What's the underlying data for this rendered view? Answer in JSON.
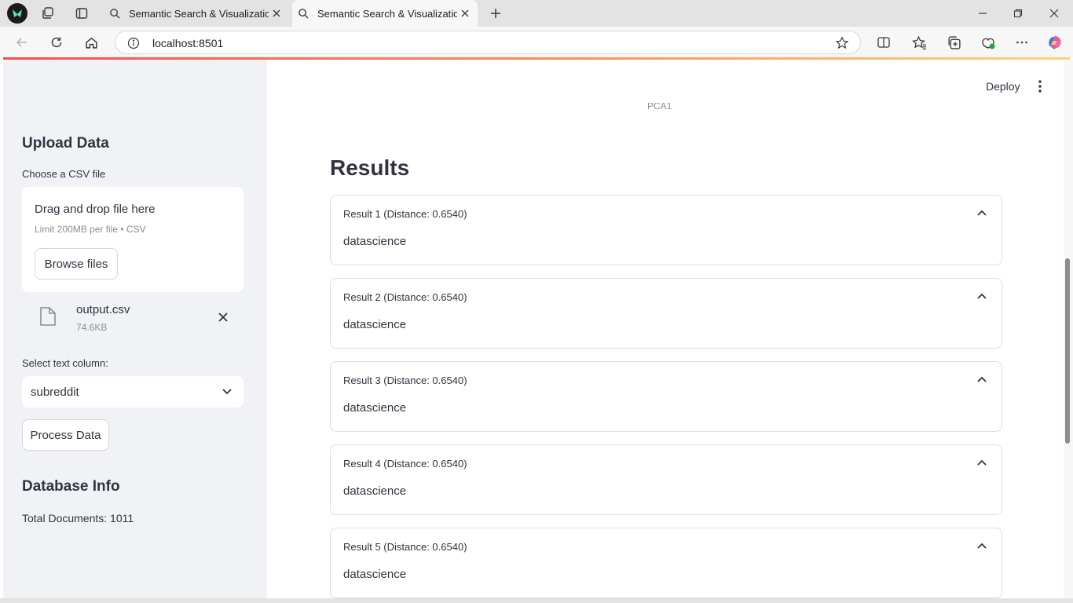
{
  "browser": {
    "tabs": [
      {
        "title": "Semantic Search & Visualization",
        "active": false
      },
      {
        "title": "Semantic Search & Visualization",
        "active": true
      }
    ],
    "url": "localhost:8501",
    "icons": [
      "back-icon",
      "refresh-icon",
      "home-icon",
      "info-icon",
      "star-icon",
      "split-screen-icon",
      "favorites-icon",
      "collections-icon",
      "browser-essentials-icon",
      "more-icon",
      "copilot-icon"
    ]
  },
  "sidebar": {
    "upload_heading": "Upload Data",
    "file_label": "Choose a CSV file",
    "dropzone_title": "Drag and drop file here",
    "dropzone_limit": "Limit 200MB per file • CSV",
    "browse_label": "Browse files",
    "uploaded_file": {
      "name": "output.csv",
      "size": "74.6KB"
    },
    "column_label": "Select text column:",
    "column_value": "subreddit",
    "process_label": "Process Data",
    "db_heading": "Database Info",
    "total_docs": "Total Documents: 1011"
  },
  "main": {
    "deploy_label": "Deploy",
    "axis_label_cut": "PCA1",
    "results_heading": "Results",
    "results": [
      {
        "title": "Result 1 (Distance: 0.6540)",
        "text": "datascience"
      },
      {
        "title": "Result 2 (Distance: 0.6540)",
        "text": "datascience"
      },
      {
        "title": "Result 3 (Distance: 0.6540)",
        "text": "datascience"
      },
      {
        "title": "Result 4 (Distance: 0.6540)",
        "text": "datascience"
      },
      {
        "title": "Result 5 (Distance: 0.6540)",
        "text": "datascience"
      }
    ]
  },
  "colors": {
    "sidebar_bg": "#f0f2f6",
    "accent": "#ff4b4b",
    "text": "#31333f"
  }
}
